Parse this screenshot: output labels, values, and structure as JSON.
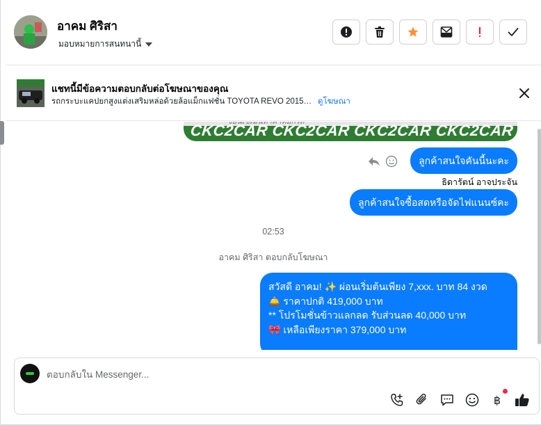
{
  "header": {
    "contact_name": "อาคม ศิริสา",
    "assign_label": "มอบหมายการสนทนานี้",
    "actions": [
      "important-icon",
      "trash-icon",
      "star-icon",
      "mark-unread-icon",
      "spam-icon",
      "check-icon"
    ],
    "star_color": "#f7923a",
    "spam_color": "#e41e3f"
  },
  "ad_banner": {
    "title": "แชทนี้มีข้อความตอบกลับต่อโฆษณาของคุณ",
    "description": "รถกระบะแคปยกสูงแต่งเสริมหล่อด้วยล้อแม็กแฟชั่น TOYOTA REVO 2015 เกียร์...",
    "link_label": "ดูโฆษณา"
  },
  "thread": {
    "image_brand_text": "CKC2CAR CKC2CAR CKC2CAR CKC2CAR CKC2CAR",
    "image_watermark": "*งอนเขเมนทาคาทอกรถ",
    "messages": [
      {
        "text": "ลูกค้าสนใจคันนี้นะคะ"
      },
      {
        "sender": "ธิดารัตน์ อาจประจัน",
        "text": "ลูกค้าสนใจซื้อสดหรือจัดไฟแนนซ์คะ"
      }
    ],
    "timestamp": "02:53",
    "ad_reply_note": "อาคม ศิริสา ตอบกลับโฆษณา",
    "ad_message_lines": [
      "สวัสดี อาคม! ✨  ผ่อนเริ่มต้นเพียง 7,xxx. บาท 84 งวด",
      "🛎️ ราคาปกติ 419,000 บาท",
      "** โปรโมชั่นข้าวแลกลด รับส่วนลด 40,000 บาท",
      "🎀  เหลือเพียงราคา 379,000 บาท"
    ],
    "bubble_color": "#0a7cff"
  },
  "composer": {
    "placeholder": "ตอบกลับใน Messenger...",
    "tools": [
      "call-icon",
      "attachment-icon",
      "saved-reply-icon",
      "emoji-icon",
      "payment-icon",
      "like-icon"
    ],
    "payment_symbol": "฿"
  }
}
